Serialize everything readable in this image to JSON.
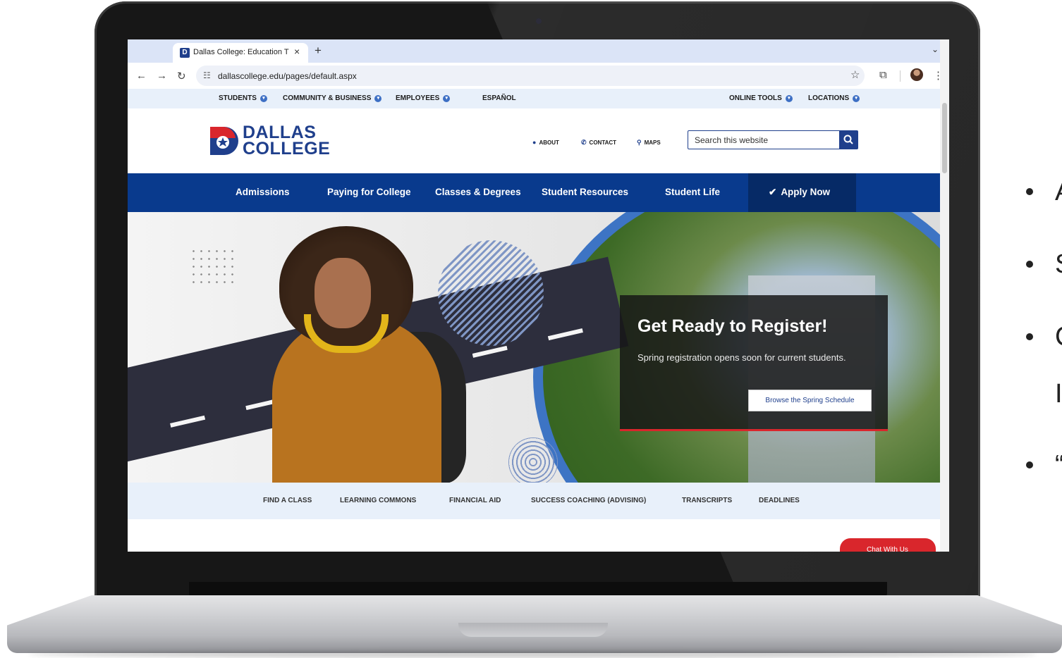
{
  "browser": {
    "tab_title": "Dallas College: Education That Works",
    "new_tab_symbol": "+",
    "url": "dallascollege.edu/pages/default.aspx"
  },
  "utility_nav": {
    "items": [
      {
        "label": "STUDENTS"
      },
      {
        "label": "COMMUNITY & BUSINESS"
      },
      {
        "label": "EMPLOYEES"
      },
      {
        "label": "ESPAÑOL"
      },
      {
        "label": "ONLINE TOOLS"
      },
      {
        "label": "LOCATIONS"
      }
    ]
  },
  "header": {
    "logo_line1": "DALLAS",
    "logo_line2": "COLLEGE",
    "links": [
      {
        "label": "ABOUT",
        "icon": "info-icon"
      },
      {
        "label": "CONTACT",
        "icon": "phone-icon"
      },
      {
        "label": "MAPS",
        "icon": "map-pin-icon"
      }
    ],
    "search_placeholder": "Search this website"
  },
  "main_nav": {
    "items": [
      {
        "label": "Admissions"
      },
      {
        "label": "Paying for College"
      },
      {
        "label": "Classes & Degrees"
      },
      {
        "label": "Student Resources"
      },
      {
        "label": "Student Life"
      }
    ],
    "apply_label": "Apply Now"
  },
  "hero": {
    "title": "Get Ready to Register!",
    "body": "Spring registration opens soon for current students.",
    "button_label": "Browse the Spring Schedule"
  },
  "quick_links": {
    "items": [
      {
        "label": "FIND A CLASS"
      },
      {
        "label": "LEARNING COMMONS"
      },
      {
        "label": "FINANCIAL AID"
      },
      {
        "label": "SUCCESS COACHING (ADVISING)"
      },
      {
        "label": "TRANSCRIPTS"
      },
      {
        "label": "DEADLINES"
      }
    ]
  },
  "chat": {
    "label": "Chat With Us"
  },
  "slide_bullets": {
    "items": [
      {
        "text": "A"
      },
      {
        "text": "S"
      },
      {
        "text": "C"
      },
      {
        "text": "I"
      },
      {
        "text": "“"
      }
    ]
  },
  "colors": {
    "brand_blue": "#093a8d",
    "brand_red": "#d9262c",
    "utility_bg": "#e8f0fa"
  }
}
